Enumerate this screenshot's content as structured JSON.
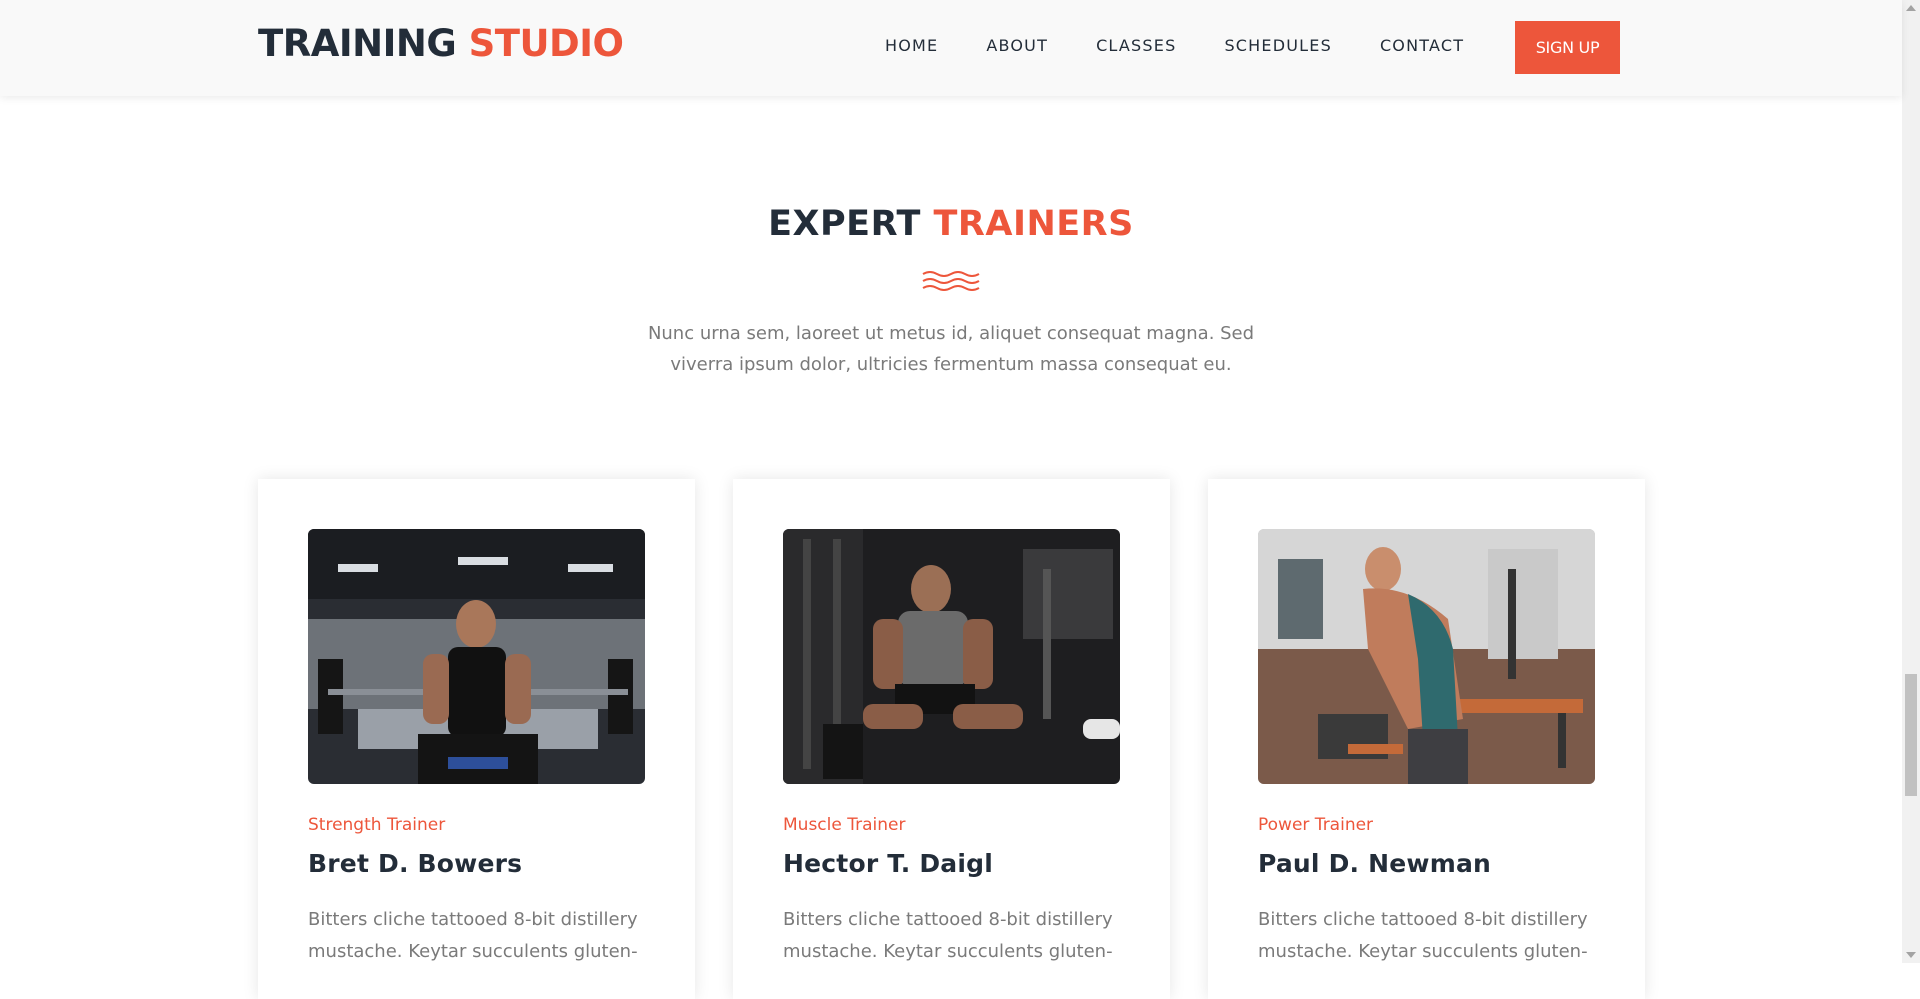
{
  "brand": {
    "part1": "TRAINING",
    "part2": "STUDIO"
  },
  "nav": {
    "items": [
      "HOME",
      "ABOUT",
      "CLASSES",
      "SCHEDULES",
      "CONTACT"
    ],
    "signup": "SIGN UP"
  },
  "section": {
    "title_part1": "EXPERT",
    "title_part2": "TRAINERS",
    "subtitle": "Nunc urna sem, laoreet ut metus id, aliquet consequat magna. Sed viverra ipsum dolor, ultricies fermentum massa consequat eu."
  },
  "trainers": [
    {
      "role": "Strength Trainer",
      "name": "Bret D. Bowers",
      "bio": "Bitters cliche tattooed 8-bit distillery mustache. Keytar succulents gluten-"
    },
    {
      "role": "Muscle Trainer",
      "name": "Hector T. Daigl",
      "bio": "Bitters cliche tattooed 8-bit distillery mustache. Keytar succulents gluten-"
    },
    {
      "role": "Power Trainer",
      "name": "Paul D. Newman",
      "bio": "Bitters cliche tattooed 8-bit distillery mustache. Keytar succulents gluten-"
    }
  ],
  "colors": {
    "accent": "#ed563b",
    "dark": "#232d39",
    "muted": "#7a7a7a"
  }
}
